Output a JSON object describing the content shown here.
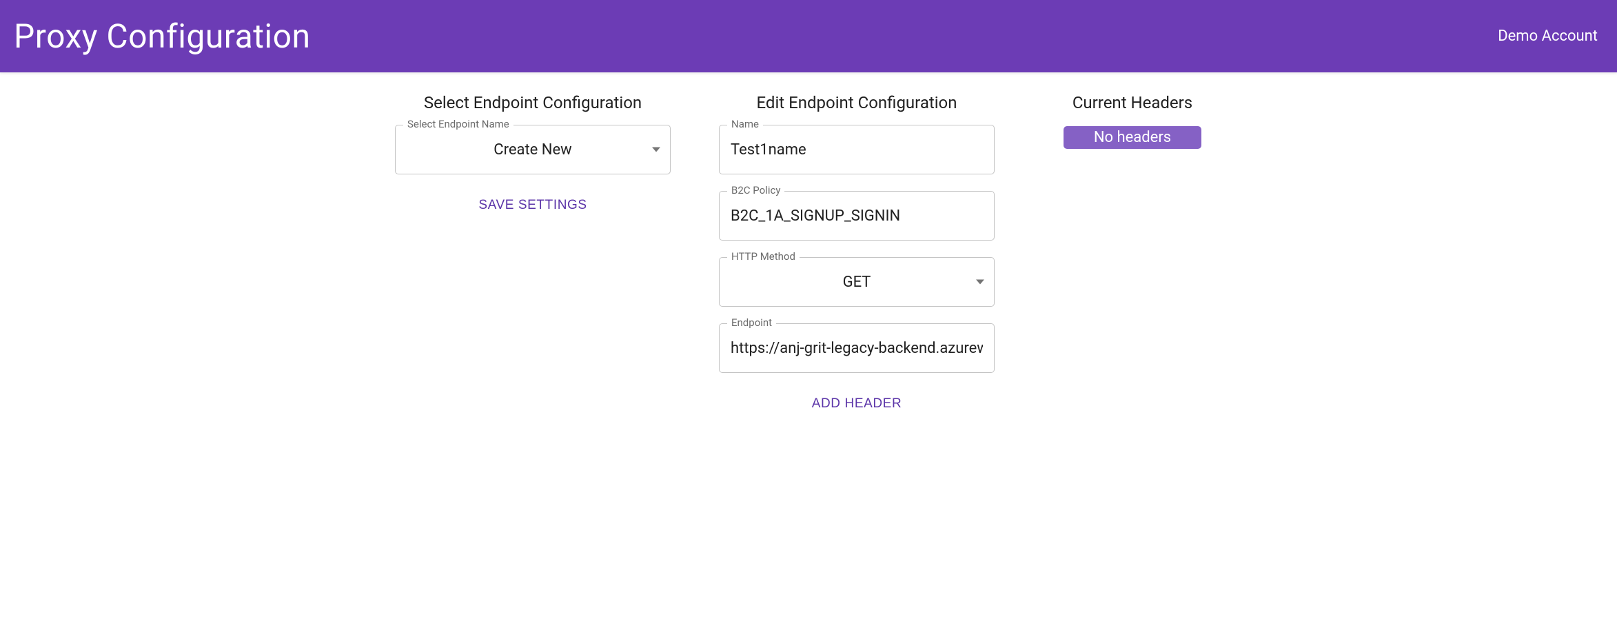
{
  "header": {
    "title": "Proxy Configuration",
    "account": "Demo Account"
  },
  "select_section": {
    "title": "Select Endpoint Configuration",
    "endpoint_name": {
      "label": "Select Endpoint Name",
      "value": "Create New"
    },
    "save_button": "Save Settings"
  },
  "edit_section": {
    "title": "Edit Endpoint Configuration",
    "name": {
      "label": "Name",
      "value": "Test1name"
    },
    "b2c_policy": {
      "label": "B2C Policy",
      "value": "B2C_1A_SIGNUP_SIGNIN"
    },
    "http_method": {
      "label": "HTTP Method",
      "value": "GET"
    },
    "endpoint": {
      "label": "Endpoint",
      "value": "https://anj-grit-legacy-backend.azurew"
    },
    "add_header_button": "Add Header"
  },
  "headers_section": {
    "title": "Current Headers",
    "no_headers_label": "No headers"
  },
  "colors": {
    "primary": "#6c3cb5",
    "accent": "#5b34a8",
    "badge": "#8561c5"
  }
}
